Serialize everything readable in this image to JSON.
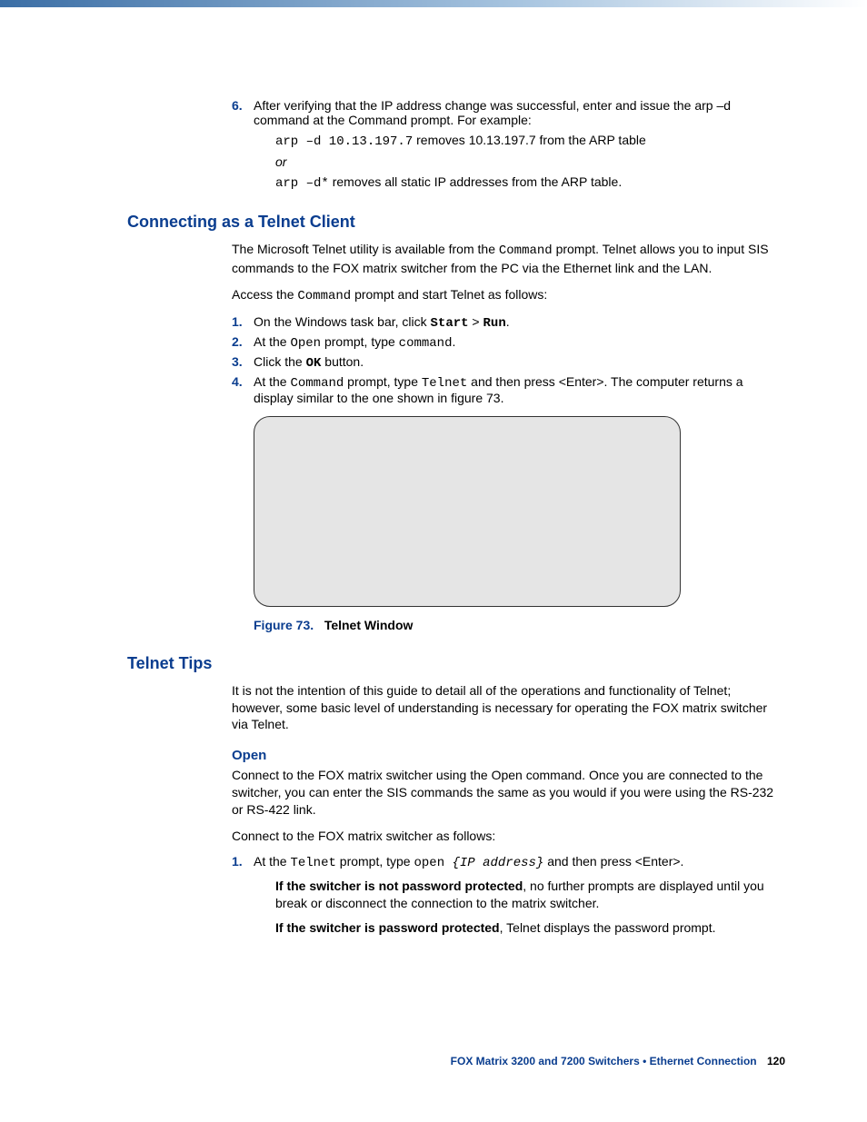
{
  "step6": {
    "num": "6.",
    "text": "After verifying that the IP address change was successful, enter and issue the arp –d command at the Command prompt. For example:",
    "ex1_cmd": "arp –d 10.13.197.7",
    "ex1_text": " removes 10.13.197.7 from the ARP table",
    "or": "or",
    "ex2_cmd": "arp –d*",
    "ex2_text": " removes all static IP addresses from the ARP table."
  },
  "telnet_client": {
    "heading": "Connecting as a Telnet Client",
    "p1a": "The Microsoft Telnet utility is available from the ",
    "p1b": "Command",
    "p1c": " prompt. Telnet allows you to input SIS commands to the FOX matrix switcher from the PC via the Ethernet link and the LAN.",
    "p2a": "Access the ",
    "p2b": "Command",
    "p2c": " prompt and start Telnet as follows:",
    "s1": {
      "num": "1.",
      "a": "On the Windows task bar, click ",
      "b": "Start",
      "c": " > ",
      "d": "Run",
      "e": "."
    },
    "s2": {
      "num": "2.",
      "a": "At the ",
      "b": "Open",
      "c": " prompt, type ",
      "d": "command",
      "e": "."
    },
    "s3": {
      "num": "3.",
      "a": "Click the ",
      "b": "OK",
      "c": " button."
    },
    "s4": {
      "num": "4.",
      "a": "At the ",
      "b": "Command",
      "c": " prompt, type ",
      "d": "Telnet",
      "e": " and then press <Enter>. The computer returns a display similar to the one shown in figure 73."
    },
    "fig_label": "Figure 73.",
    "fig_title": "Telnet Window"
  },
  "telnet_tips": {
    "heading": "Telnet Tips",
    "p1": "It is not the intention of this guide to detail all of the operations and functionality of Telnet; however, some basic level of understanding is necessary for operating the FOX matrix switcher via Telnet.",
    "open_heading": "Open",
    "open_p1": "Connect to the FOX matrix switcher using the Open command. Once you are connected to the switcher, you can enter the SIS commands the same as you would if you were using the RS-232 or RS-422 link.",
    "open_p2": "Connect to the FOX matrix switcher as follows:",
    "s1": {
      "num": "1.",
      "a": "At the ",
      "b": "Telnet",
      "c": " prompt, type ",
      "d": "open ",
      "e": "{IP address}",
      "f": " and then press <Enter>."
    },
    "note1a": "If the switcher is not password protected",
    "note1b": ", no further prompts are displayed until you break or disconnect the connection to the matrix switcher.",
    "note2a": "If the switcher is password protected",
    "note2b": ", Telnet displays the password prompt."
  },
  "footer": {
    "text": "FOX Matrix 3200 and 7200 Switchers • Ethernet Connection",
    "page": "120"
  }
}
